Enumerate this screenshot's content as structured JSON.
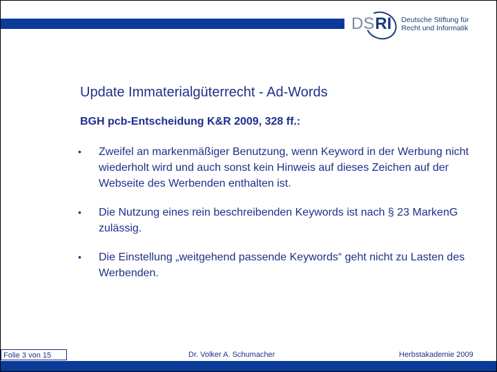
{
  "header": {
    "logo_mark_ds": "DS",
    "logo_mark_ri": "RI",
    "logo_line1": "Deutsche Stiftung für",
    "logo_line2": "Recht und Informatik"
  },
  "slide": {
    "title": "Update Immaterialgüterrecht - Ad-Words",
    "subtitle": "BGH pcb-Entscheidung K&R 2009, 328 ff.:",
    "bullet_symbol": "•",
    "bullets": [
      "Zweifel an markenmäßiger Benutzung, wenn Keyword in der Werbung nicht wiederholt wird und auch sonst kein Hinweis auf dieses Zeichen auf der Webseite des Werbenden enthalten ist.",
      "Die Nutzung eines rein beschreibenden Keywords ist nach § 23 MarkenG zulässig.",
      "Die Einstellung „weitgehend passende Keywords“ geht nicht zu Lasten des Werbenden."
    ]
  },
  "footer": {
    "page": "Folie 3 von 15",
    "author": "Dr. Volker A. Schumacher",
    "event": "Herbstakademie 2009"
  },
  "colors": {
    "brand_blue": "#0a3a9a",
    "text_blue": "#1f2f8a"
  }
}
